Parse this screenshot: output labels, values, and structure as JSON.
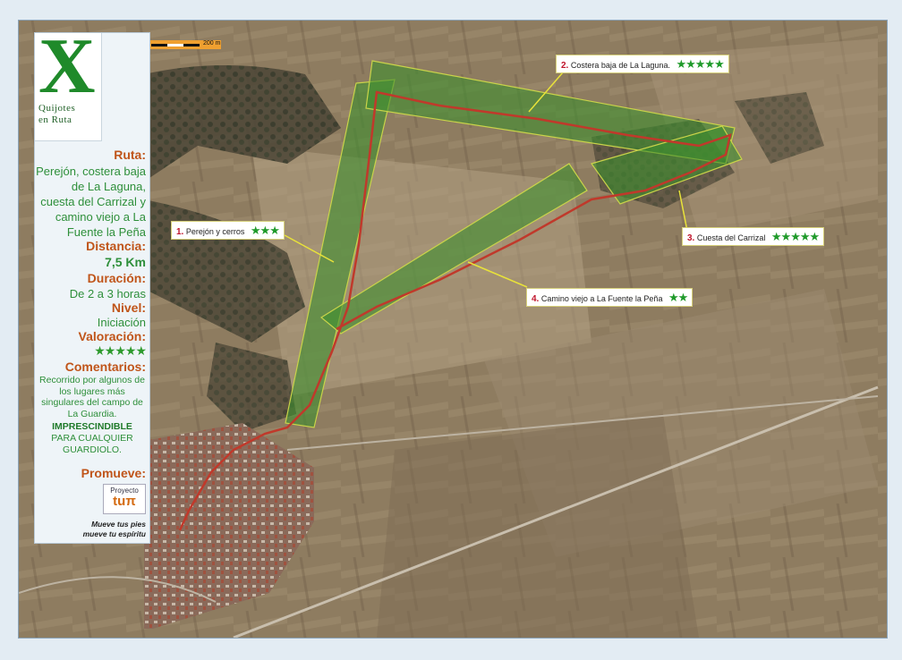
{
  "colors": {
    "route_band": "#3e8f2e",
    "route_line": "#c0392b",
    "leader": "#e8e23a",
    "label_orange": "#c0551a",
    "label_green": "#2e8f3a",
    "star_green": "#1f9a2a"
  },
  "scale_bar": {
    "label": "200 m"
  },
  "logo": {
    "letter": "X",
    "line1": "Quijotes",
    "line2": "en Ruta"
  },
  "sidebar": {
    "ruta_label": "Ruta:",
    "ruta_value": "Perejón, costera baja de La Laguna, cuesta del Carrizal y camino viejo a La Fuente la Peña",
    "distancia_label": "Distancia:",
    "distancia_value": "7,5 Km",
    "duracion_label": "Duración:",
    "duracion_value": "De 2 a 3 horas",
    "nivel_label": "Nivel:",
    "nivel_value": "Iniciación",
    "valoracion_label": "Valoración:",
    "valoracion_stars": "★★★★★",
    "comentarios_label": "Comentarios:",
    "comentarios_value": "Recorrido por algunos de los lugares más singulares del campo de La Guardia.",
    "comentarios_emphasis": "IMPRESCINDIBLE",
    "comentarios_tail": "PARA CUALQUIER GUARDIOLO.",
    "promueve_label": "Promueve:",
    "promo_top": "Proyecto",
    "promo_logo": "tuπ",
    "motto_1": "Mueve tus pies",
    "motto_2": "mueve tu espíritu"
  },
  "callouts": [
    {
      "num": "1.",
      "text": "Perejón y cerros",
      "stars": "★★★"
    },
    {
      "num": "2.",
      "text": "Costera baja de La Laguna.",
      "stars": "★★★★★"
    },
    {
      "num": "3.",
      "text": "Cuesta del Carrizal",
      "stars": "★★★★★"
    },
    {
      "num": "4.",
      "text": "Camino viejo a La Fuente la Peña",
      "stars": "★★"
    }
  ],
  "map_icons": [
    "town-icon",
    "route-band",
    "route-line",
    "leader-line"
  ]
}
